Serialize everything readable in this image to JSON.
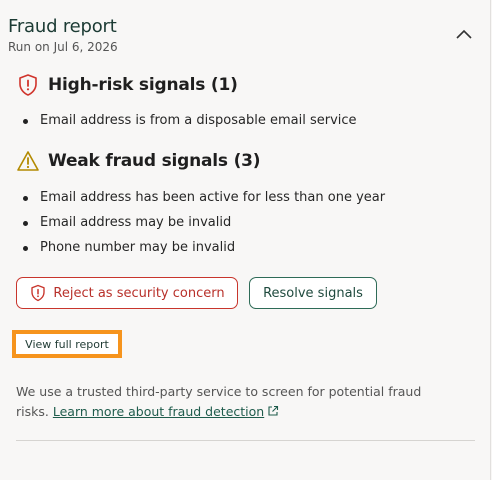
{
  "header": {
    "title": "Fraud report",
    "subtitle": "Run on Jul 6, 2026",
    "collapse_icon": "chevron-up-icon"
  },
  "high_risk": {
    "icon": "shield-alert-icon",
    "icon_color": "#d0342c",
    "title": "High-risk signals (1)",
    "items": [
      "Email address is from a disposable email service"
    ]
  },
  "weak": {
    "icon": "warning-triangle-icon",
    "icon_color": "#b38a00",
    "title": "Weak fraud signals (3)",
    "items": [
      "Email address has been active for less than one year",
      "Email address may be invalid",
      "Phone number may be invalid"
    ]
  },
  "actions": {
    "reject_label": "Reject as security concern",
    "resolve_label": "Resolve signals"
  },
  "view_full_report": "View full report",
  "footer": {
    "text": "We use a trusted third-party service to screen for potential fraud risks.",
    "link_label": "Learn more about fraud detection",
    "link_icon": "external-link-icon"
  },
  "colors": {
    "danger": "#c8352c",
    "brand_green": "#2e6b57",
    "highlight": "#f6941d"
  }
}
